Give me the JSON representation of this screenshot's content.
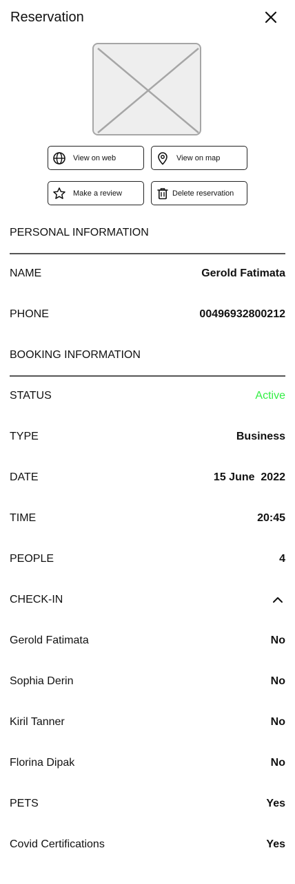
{
  "header": {
    "title": "Reservation",
    "close_icon": "close-icon"
  },
  "actions": {
    "view_web": "View on web",
    "view_map": "View on map",
    "review": "Make a review",
    "delete": "Delete reservation"
  },
  "personal": {
    "section_title": "PERSONAL INFORMATION",
    "name_label": "NAME",
    "name_value": "Gerold Fatimata",
    "phone_label": "PHONE",
    "phone_value": "00496932800212"
  },
  "booking": {
    "section_title": "BOOKING INFORMATION",
    "status_label": "STATUS",
    "status_value": "Active",
    "status_color": "#33ee44",
    "type_label": "TYPE",
    "type_value": "Business",
    "date_label": "DATE",
    "date_value": "15 June  2022",
    "time_label": "TIME",
    "time_value": "20:45",
    "people_label": "PEOPLE",
    "people_value": "4",
    "checkin_label": "CHECK-IN",
    "checkin_icon": "chevron-up-icon",
    "guests": [
      {
        "name": "Gerold Fatimata",
        "checked_in": "No"
      },
      {
        "name": "Sophia Derin",
        "checked_in": "No"
      },
      {
        "name": "Kiril Tanner",
        "checked_in": "No"
      },
      {
        "name": "Florina Dipak",
        "checked_in": "No"
      }
    ],
    "pets_label": "PETS",
    "pets_value": "Yes",
    "covid_label": "Covid Certifications",
    "covid_value": "Yes"
  }
}
